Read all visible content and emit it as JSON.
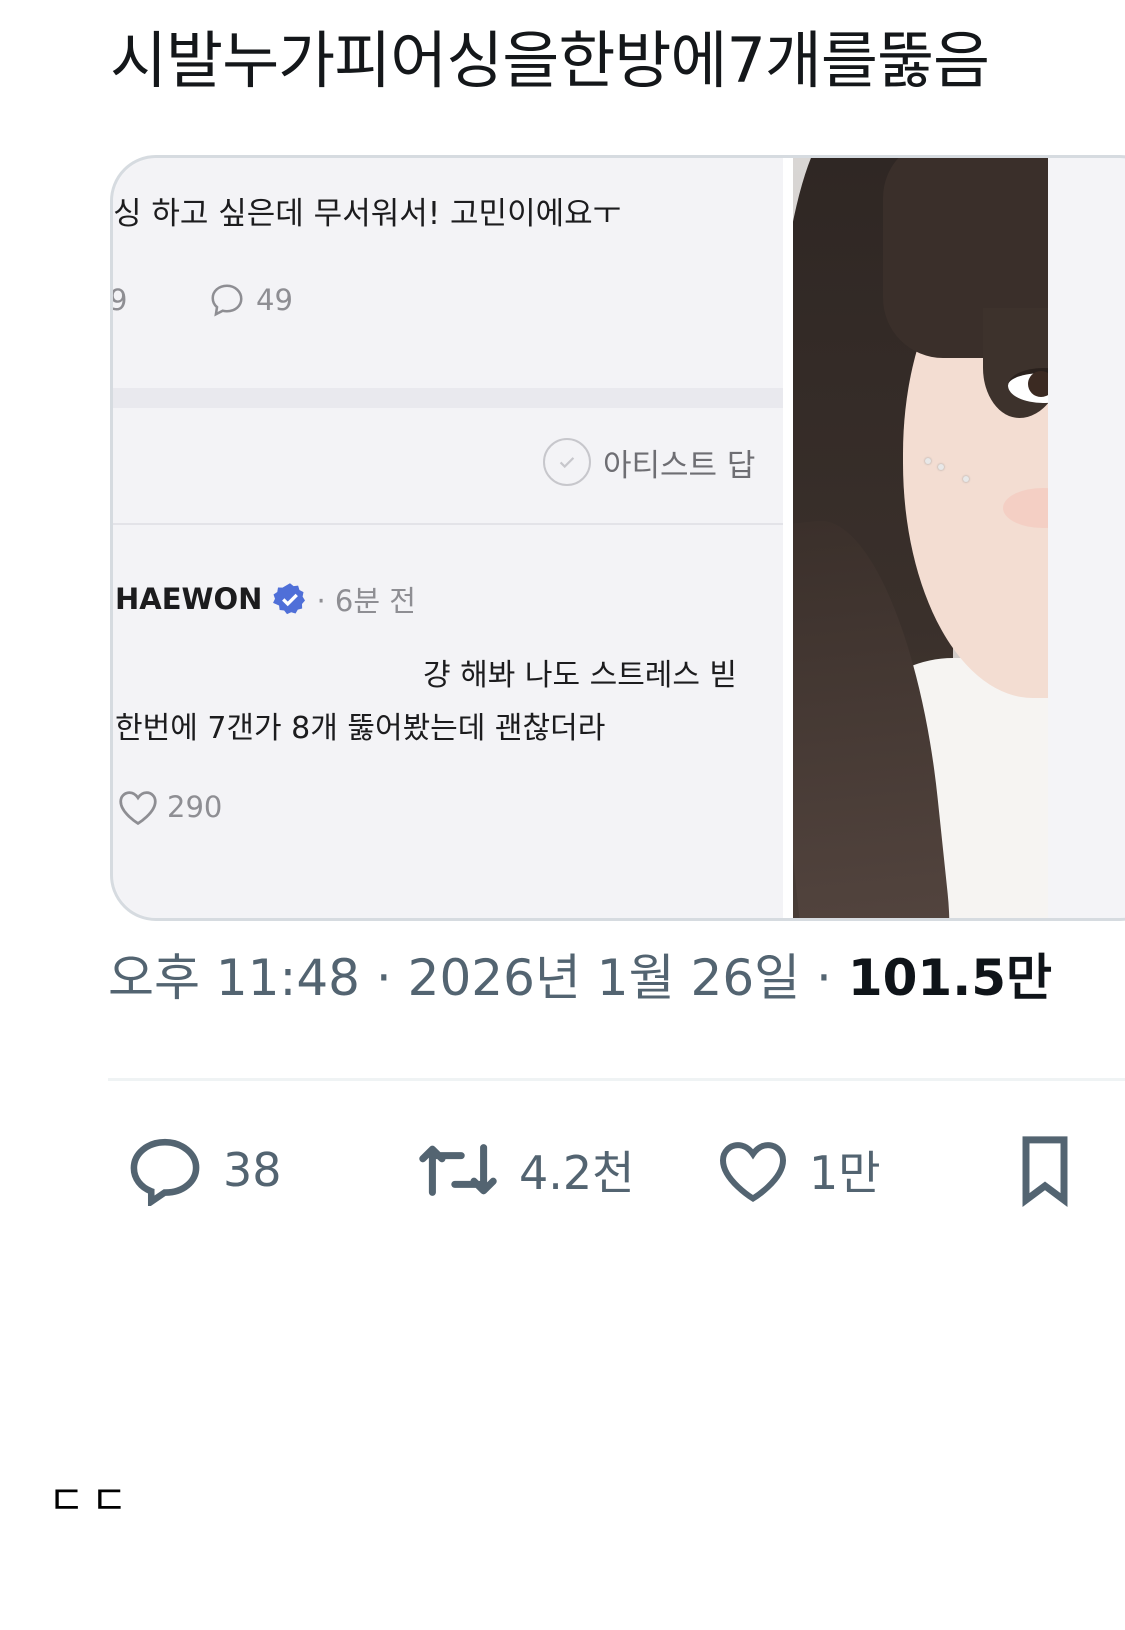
{
  "post": {
    "text": "시발누가피어싱을한방에7개를뚫음"
  },
  "media": {
    "question_line": "싱 하고 싶은데 무서워서! 고민이에요ㅜ",
    "cut_count": "9",
    "comment_count": "49",
    "artist_filter": "아티스트 답",
    "reply": {
      "author": "HAEWON",
      "time": "· 6분 전",
      "line1": "걍 해봐 나도 스트레스 빋",
      "line2": "한번에 7갠가 8개 뚫어봤는데 괜찮더라",
      "likes": "290"
    }
  },
  "meta": {
    "time_date": "오후 11:48 · 2026년 1월 26일 · ",
    "views": "101.5만"
  },
  "actions": {
    "replies": "38",
    "retweets": "4.2천",
    "likes": "1만"
  },
  "footer": {
    "text": "ㄷㄷ"
  },
  "colors": {
    "muted": "#536471",
    "verified": "#4f6fd8",
    "border": "#d6dbe0"
  }
}
